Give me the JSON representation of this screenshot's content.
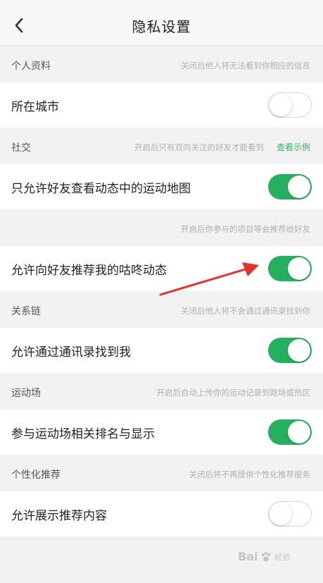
{
  "header": {
    "title": "隐私设置"
  },
  "sections": [
    {
      "title": "个人资料",
      "desc": "关闭后他人将无法看到你相应的信息",
      "rows": [
        {
          "label": "所在城市",
          "on": false
        }
      ]
    },
    {
      "title": "社交",
      "desc": "开启后只有双向关注的好友才能看到",
      "link": "查看示例",
      "rows": [
        {
          "label": "只允许好友查看动态中的运动地图",
          "on": true
        }
      ]
    },
    {
      "title": "",
      "desc": "开启后你参与的项目等会推荐给好友",
      "rows": [
        {
          "label": "允许向好友推荐我的咕咚动态",
          "on": true
        }
      ]
    },
    {
      "title": "关系链",
      "desc": "关闭后他人将不会通过通讯录找到你",
      "rows": [
        {
          "label": "允许通过通讯录找到我",
          "on": true
        }
      ]
    },
    {
      "title": "运动场",
      "desc": "开启后自动上传你的运动记录到跑场或热区",
      "rows": [
        {
          "label": "参与运动场相关排名与显示",
          "on": true
        }
      ]
    },
    {
      "title": "个性化推荐",
      "desc": "关闭后将不再提供个性化推荐服务",
      "rows": [
        {
          "label": "允许展示推荐内容",
          "on": false
        }
      ]
    }
  ],
  "watermark": {
    "text": "Bai",
    "sub": "经验"
  },
  "colors": {
    "accent": "#25b05f",
    "link": "#2eb566",
    "annotation_arrow": "#e8302a"
  }
}
